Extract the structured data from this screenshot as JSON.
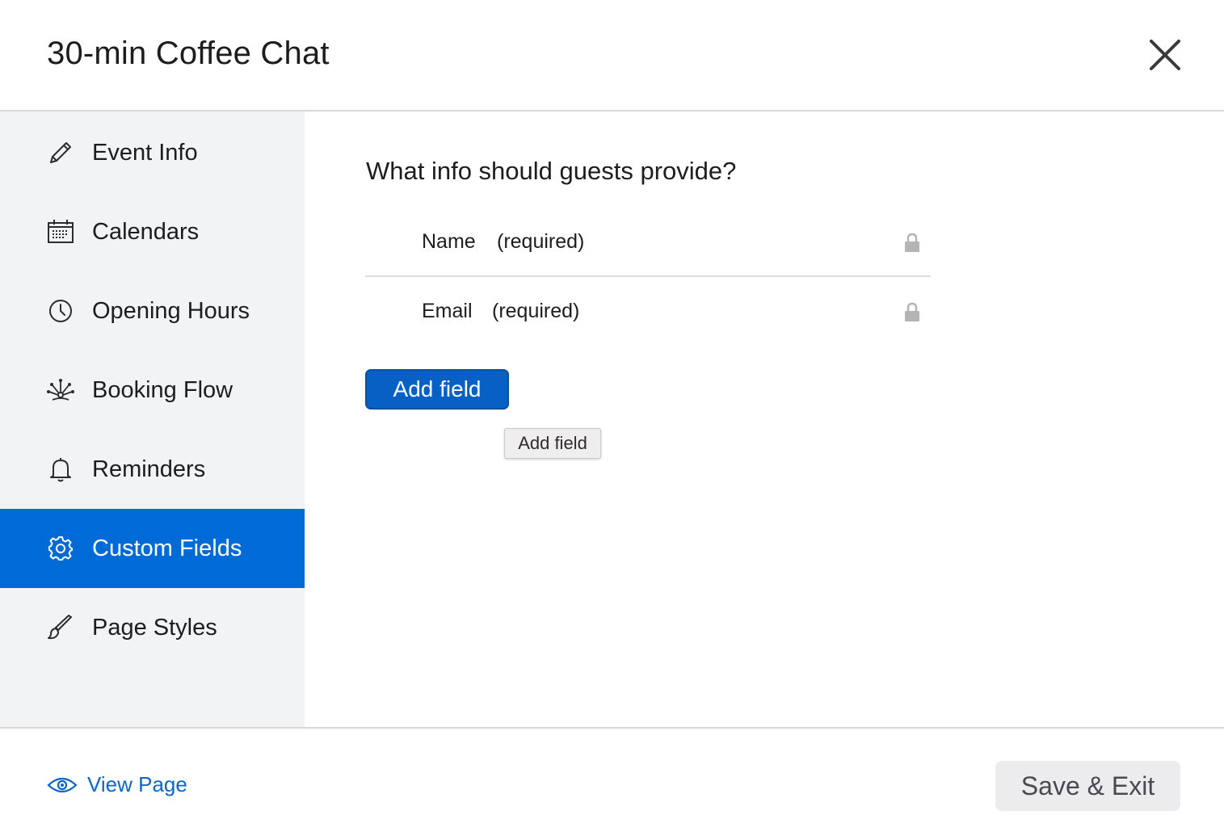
{
  "dialog": {
    "title": "30-min Coffee Chat"
  },
  "sidebar": {
    "items": [
      {
        "label": "Event Info",
        "icon": "pencil-icon"
      },
      {
        "label": "Calendars",
        "icon": "calendar-icon"
      },
      {
        "label": "Opening Hours",
        "icon": "clock-icon"
      },
      {
        "label": "Booking Flow",
        "icon": "flow-icon"
      },
      {
        "label": "Reminders",
        "icon": "bell-icon"
      },
      {
        "label": "Custom Fields",
        "icon": "gear-icon",
        "active": true
      },
      {
        "label": "Page Styles",
        "icon": "brush-icon"
      }
    ]
  },
  "main": {
    "question": "What info should guests provide?",
    "fields": [
      {
        "name": "Name",
        "status": "(required)",
        "icon": "lock-icon"
      },
      {
        "name": "Email",
        "status": "(required)",
        "icon": "lock-icon"
      }
    ],
    "add_button_label": "Add field",
    "tooltip": "Add field"
  },
  "footer": {
    "view_page_label": "View Page",
    "save_exit_label": "Save & Exit"
  },
  "colors": {
    "accent": "#006bd6",
    "button": "#0760c4",
    "link": "#0a66c8",
    "sidebar_bg": "#f2f3f5"
  }
}
